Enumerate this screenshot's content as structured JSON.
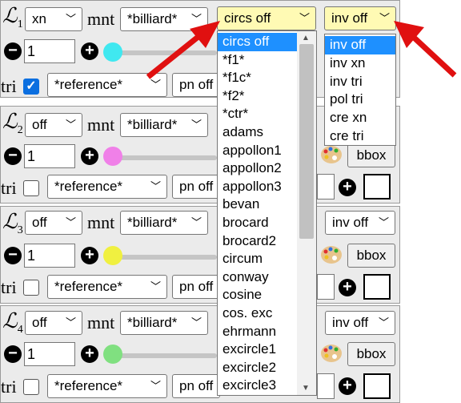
{
  "panels": [
    {
      "label_num": "1",
      "conic_value": "xn",
      "mnt_label": "mnt",
      "mnt_value": "*billiard*",
      "circs_value": "circs off",
      "inv_value": "inv off",
      "stepper_value": "1",
      "thumb_color": "#40e8f0",
      "tri_label": "tri",
      "tri_checked": true,
      "tri_value": "*reference*",
      "pn_value": "pn off"
    },
    {
      "label_num": "2",
      "conic_value": "off",
      "mnt_label": "mnt",
      "mnt_value": "*billiard*",
      "stepper_value": "1",
      "thumb_color": "#f080e8",
      "tri_label": "tri",
      "tri_checked": false,
      "tri_value": "*reference*",
      "pn_value": "pn off",
      "bbox_label": "bbox"
    },
    {
      "label_num": "3",
      "conic_value": "off",
      "mnt_label": "mnt",
      "mnt_value": "*billiard*",
      "inv_value": "inv off",
      "stepper_value": "1",
      "thumb_color": "#f0f040",
      "tri_label": "tri",
      "tri_checked": false,
      "tri_value": "*reference*",
      "pn_value": "pn off",
      "bbox_label": "bbox"
    },
    {
      "label_num": "4",
      "conic_value": "off",
      "mnt_label": "mnt",
      "mnt_value": "*billiard*",
      "inv_value": "inv off",
      "stepper_value": "1",
      "thumb_color": "#80e080",
      "tri_label": "tri",
      "tri_checked": false,
      "tri_value": "*reference*",
      "pn_value": "pn off",
      "bbox_label": "bbox"
    }
  ],
  "circs_dropdown": {
    "selected": "circs off",
    "options": [
      "circs off",
      "*f1*",
      "*f1c*",
      "*f2*",
      "*ctr*",
      "adams",
      "appollon1",
      "appollon2",
      "appollon3",
      "bevan",
      "brocard",
      "brocard2",
      "circum",
      "conway",
      "cosine",
      "cos. exc",
      "ehrmann",
      "excircle1",
      "excircle2",
      "excircle3"
    ]
  },
  "inv_dropdown": {
    "selected": "inv off",
    "options": [
      "inv off",
      "inv xn",
      "inv tri",
      "pol tri",
      "cre xn",
      "cre tri"
    ]
  },
  "icons": {
    "minus": "minus-circle-icon",
    "plus": "plus-circle-icon",
    "palette": "palette-icon",
    "arrow": "red-arrow-icon"
  },
  "colors": {
    "panel_bg": "#ebebeb",
    "highlight": "#1e90ff",
    "select_active": "#fffab4",
    "arrow": "#e01010"
  }
}
